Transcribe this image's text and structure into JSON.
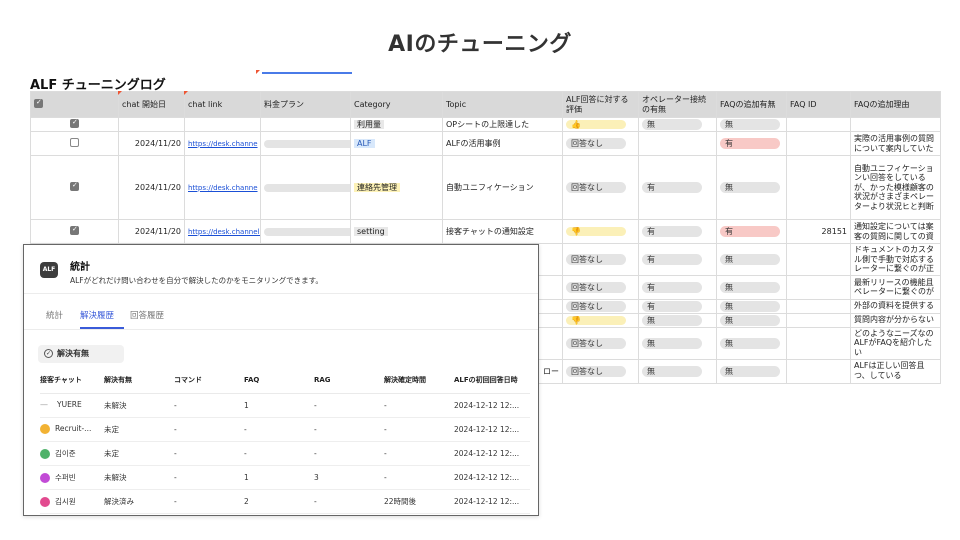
{
  "slide_title": "AIのチューニング",
  "sheet": {
    "title": "ALF チューニングログ",
    "headers": [
      "",
      "chat 開始日",
      "chat link",
      "料金プラン",
      "Category",
      "Topic",
      "ALF回答に対する評価",
      "オペレーター接続の有無",
      "FAQの追加有無",
      "FAQ ID",
      "FAQの追加理由"
    ],
    "rows": [
      {
        "checked": true,
        "date": "",
        "link": "",
        "category": "利用量",
        "topic": "OPシートの上限達した",
        "eval": "👍",
        "op": "無",
        "faq": "無",
        "faq_id": "",
        "reason": ""
      },
      {
        "checked": false,
        "date": "2024/11/20",
        "link": "https://desk.channe",
        "category": "ALF",
        "topic": "ALFの活用事例",
        "eval": "回答なし",
        "op": "",
        "faq": "有",
        "faq_id": "",
        "reason": "実際の活用事例の質問について案内していた"
      },
      {
        "checked": true,
        "date": "2024/11/20",
        "link": "https://desk.channe",
        "category": "連絡先管理",
        "topic": "自動ユニフィケーション",
        "eval": "回答なし",
        "op": "有",
        "faq": "無",
        "faq_id": "",
        "reason": "自動ユニフィケーションい回答をしているが、かった模様顧客の状況がさまざまペレーターより状況ヒと判断"
      },
      {
        "checked": true,
        "date": "2024/11/20",
        "link": "https://desk.channel.i",
        "category": "setting",
        "topic": "接客チャットの通知設定",
        "eval": "👎",
        "op": "有",
        "faq": "有",
        "faq_id": "28151",
        "reason": "通知設定については案客の質問に関しての資"
      },
      {
        "eval": "回答なし",
        "op": "有",
        "faq": "無",
        "reason": "ドキュメントのカスタル側で手動で対応するレーターに繋ぐのが正"
      },
      {
        "eval": "回答なし",
        "op": "有",
        "faq": "無",
        "reason": "最新リリースの機能且ペレーターに繋ぐのが"
      },
      {
        "eval": "回答なし",
        "op": "有",
        "faq": "無",
        "reason": "外部の資料を提供する"
      },
      {
        "eval": "👎",
        "op": "無",
        "faq": "無",
        "reason": "質問内容が分からない"
      },
      {
        "eval": "回答なし",
        "op": "無",
        "faq": "無",
        "reason": "どのようなニーズなのALFがFAQを紹介したい"
      },
      {
        "topic_tail": "ロー",
        "eval": "回答なし",
        "op": "無",
        "faq": "無",
        "reason": "ALFは正しい回答且つ、している"
      }
    ]
  },
  "panel": {
    "icon": "ALF",
    "title": "統計",
    "description": "ALFがどれだけ問い合わせを自分で解決したのかをモニタリングできます。",
    "tabs": [
      "統計",
      "解決履歴",
      "回答履歴"
    ],
    "active_tab": "解決履歴",
    "filter_label": "解決有無",
    "columns": [
      "接客チャット",
      "解決有無",
      "コマンド",
      "FAQ",
      "RAG",
      "解決確定時間",
      "ALFの初回回答日時"
    ],
    "rows": [
      {
        "avatar": "dash",
        "chat": "YUERE",
        "status": "未解決",
        "command": "-",
        "faq": "1",
        "rag": "-",
        "time": "-",
        "date": "2024-12-12 12:..."
      },
      {
        "avatar": "yellow",
        "chat": "Recruit-...",
        "status": "未定",
        "command": "-",
        "faq": "-",
        "rag": "-",
        "time": "-",
        "date": "2024-12-12 12:..."
      },
      {
        "avatar": "green",
        "chat": "김이준",
        "status": "未定",
        "command": "-",
        "faq": "-",
        "rag": "-",
        "time": "-",
        "date": "2024-12-12 12:..."
      },
      {
        "avatar": "purple",
        "chat": "수퍼빈",
        "status": "未解決",
        "command": "-",
        "faq": "1",
        "rag": "3",
        "time": "-",
        "date": "2024-12-12 12:..."
      },
      {
        "avatar": "pink",
        "chat": "김시원",
        "status": "解決済み",
        "command": "-",
        "faq": "2",
        "rag": "-",
        "time": "22時間後",
        "date": "2024-12-12 12:..."
      }
    ]
  }
}
